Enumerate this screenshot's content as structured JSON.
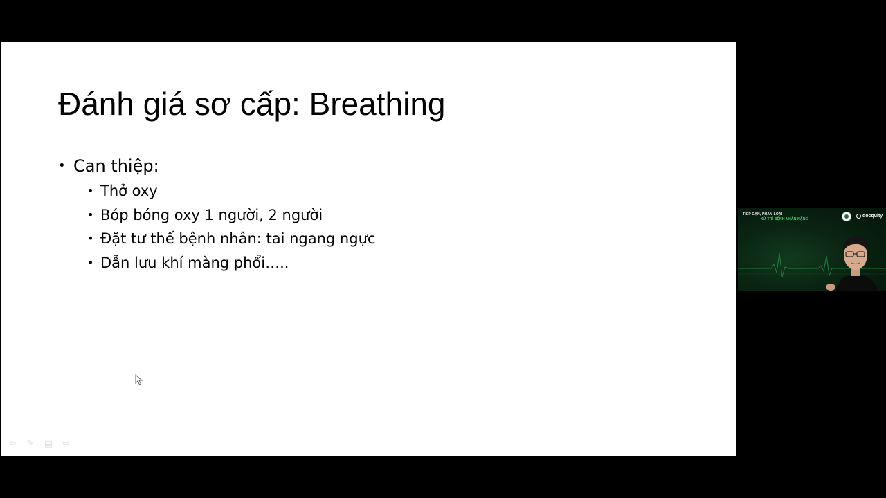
{
  "slide": {
    "title": "Đánh giá sơ cấp: Breathing",
    "bullet": "Can thiệp:",
    "sub_bullets": [
      "Thở oxy",
      "Bóp bóng oxy 1 người, 2 người",
      "Đặt tư thế bệnh nhân: tai ngang ngực",
      "Dẫn lưu khí màng phổi….."
    ]
  },
  "webcam": {
    "heading": "TIẾP CẬN, PHÂN LOẠI",
    "subheading": "XỬ TRÍ BỆNH NHÂN NẶNG",
    "brand": "docquity"
  },
  "colors": {
    "background": "#000000",
    "slide_background": "#ffffff",
    "text": "#000000",
    "webcam_accent": "#3fd86a",
    "webcam_background": "#0a2412"
  },
  "icons": {
    "cursor": "arrow-cursor-icon",
    "slide_controls": [
      "previous-slide-icon",
      "pen-icon",
      "slides-menu-icon",
      "next-slide-icon"
    ],
    "brand_logo": "docquity-logo-icon",
    "seal": "ministry-seal-icon"
  }
}
